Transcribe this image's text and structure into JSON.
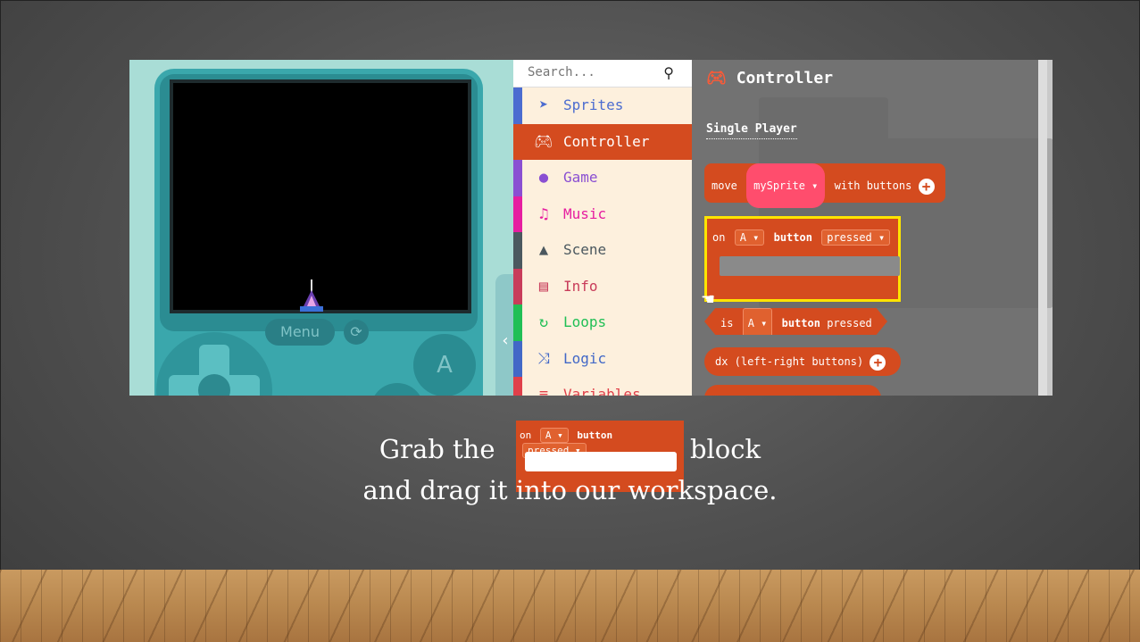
{
  "toolbox": {
    "search_placeholder": "Search...",
    "categories": [
      {
        "label": "Sprites",
        "icon": "paper-plane-icon",
        "color": "#4b6cd0"
      },
      {
        "label": "Controller",
        "icon": "gamepad-icon",
        "color": "#d44b1f"
      },
      {
        "label": "Game",
        "icon": "circle-icon",
        "color": "#8a4fd2"
      },
      {
        "label": "Music",
        "icon": "headphones-icon",
        "color": "#e61ea0"
      },
      {
        "label": "Scene",
        "icon": "tree-icon",
        "color": "#4b585f"
      },
      {
        "label": "Info",
        "icon": "id-card-icon",
        "color": "#c83c5a"
      },
      {
        "label": "Loops",
        "icon": "refresh-icon",
        "color": "#20bf55"
      },
      {
        "label": "Logic",
        "icon": "shuffle-icon",
        "color": "#4268c7"
      },
      {
        "label": "Variables",
        "icon": "list-icon",
        "color": "#e0404a"
      }
    ]
  },
  "simulator": {
    "menu_label": "Menu",
    "a_label": "A"
  },
  "flyout": {
    "title": "Controller",
    "subtitle": "Single Player",
    "block_move": {
      "prefix": "move",
      "sprite": "mySprite ▾",
      "suffix": "with buttons"
    },
    "block_on": {
      "prefix": "on",
      "button": "A ▾",
      "middle": "button",
      "event": "pressed ▾"
    },
    "block_is": {
      "prefix": "is",
      "button": "A ▾",
      "middle": "button",
      "suffix": "pressed"
    },
    "block_dx": {
      "label": "dx (left-right buttons)"
    }
  },
  "caption": {
    "line1_start": "Grab the",
    "line1_end": "block",
    "line2": "and drag it into our workspace.",
    "block": {
      "prefix": "on",
      "button": "A ▾",
      "middle": "button",
      "event": "pressed ▾"
    }
  },
  "colors": {
    "accent": "#d44b1f",
    "highlight": "#ffe400"
  }
}
